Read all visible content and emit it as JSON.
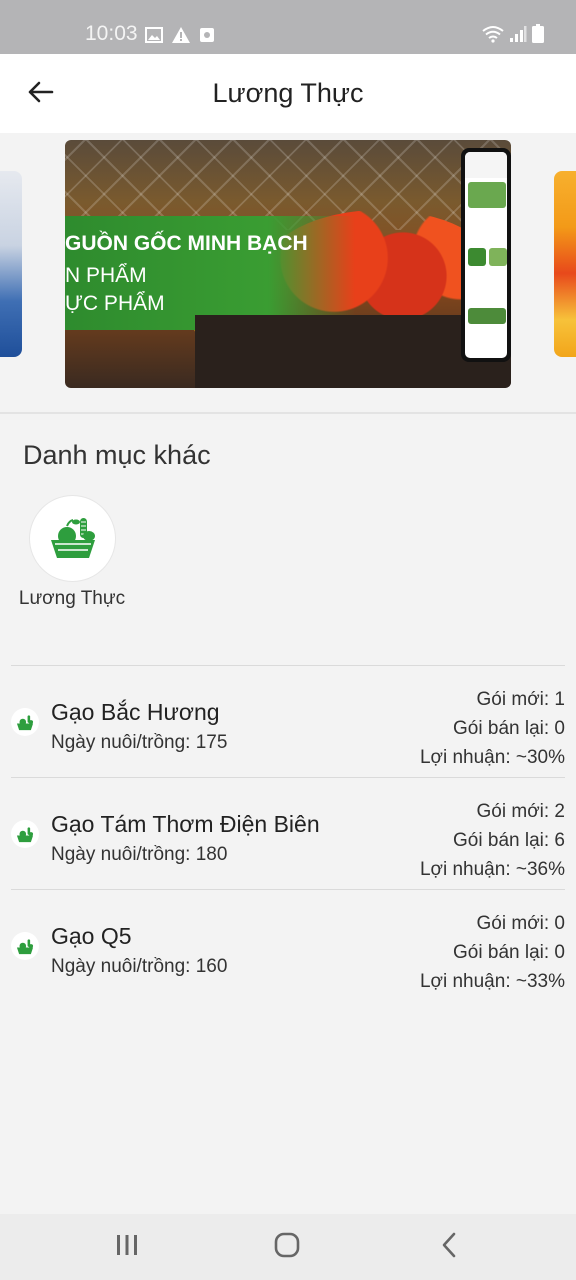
{
  "status_bar": {
    "time": "10:03",
    "left_icons": [
      "image-icon",
      "warning-icon",
      "app-notification-icon"
    ],
    "right_icons": [
      "wifi-icon",
      "signal-icon",
      "battery-icon"
    ]
  },
  "app_bar": {
    "back_icon": "arrow-left-icon",
    "title": "Lương Thực"
  },
  "banner": {
    "line1": "GUỒN GỐC MINH  BẠCH",
    "line2": "N PHẨM",
    "line3": "ỰC PHẨM"
  },
  "categories": {
    "title": "Danh mục khác",
    "items": [
      {
        "label": "Lương Thực",
        "icon": "food-basket-icon"
      }
    ]
  },
  "products": [
    {
      "name": "Gạo Bắc Hương",
      "days": "Ngày nuôi/trồng: 175",
      "new_packs": "Gói mới: 1",
      "resale_packs": "Gói bán lại: 0",
      "profit": "Lợi nhuận: ~30%"
    },
    {
      "name": "Gạo Tám Thơm Điện Biên",
      "days": "Ngày nuôi/trồng: 180",
      "new_packs": "Gói mới: 2",
      "resale_packs": "Gói bán lại: 6",
      "profit": "Lợi nhuận: ~36%"
    },
    {
      "name": "Gạo Q5",
      "days": "Ngày nuôi/trồng: 160",
      "new_packs": "Gói mới: 0",
      "resale_packs": "Gói bán lại: 0",
      "profit": "Lợi nhuận: ~33%"
    }
  ],
  "nav_bar": {
    "buttons": [
      "recent-apps-icon",
      "home-icon",
      "back-icon"
    ]
  },
  "colors": {
    "status_bar": "#b4b4b6",
    "app_bar": "#ffffff",
    "background": "#f3f3f3",
    "brand_green": "#2e9e3e"
  }
}
